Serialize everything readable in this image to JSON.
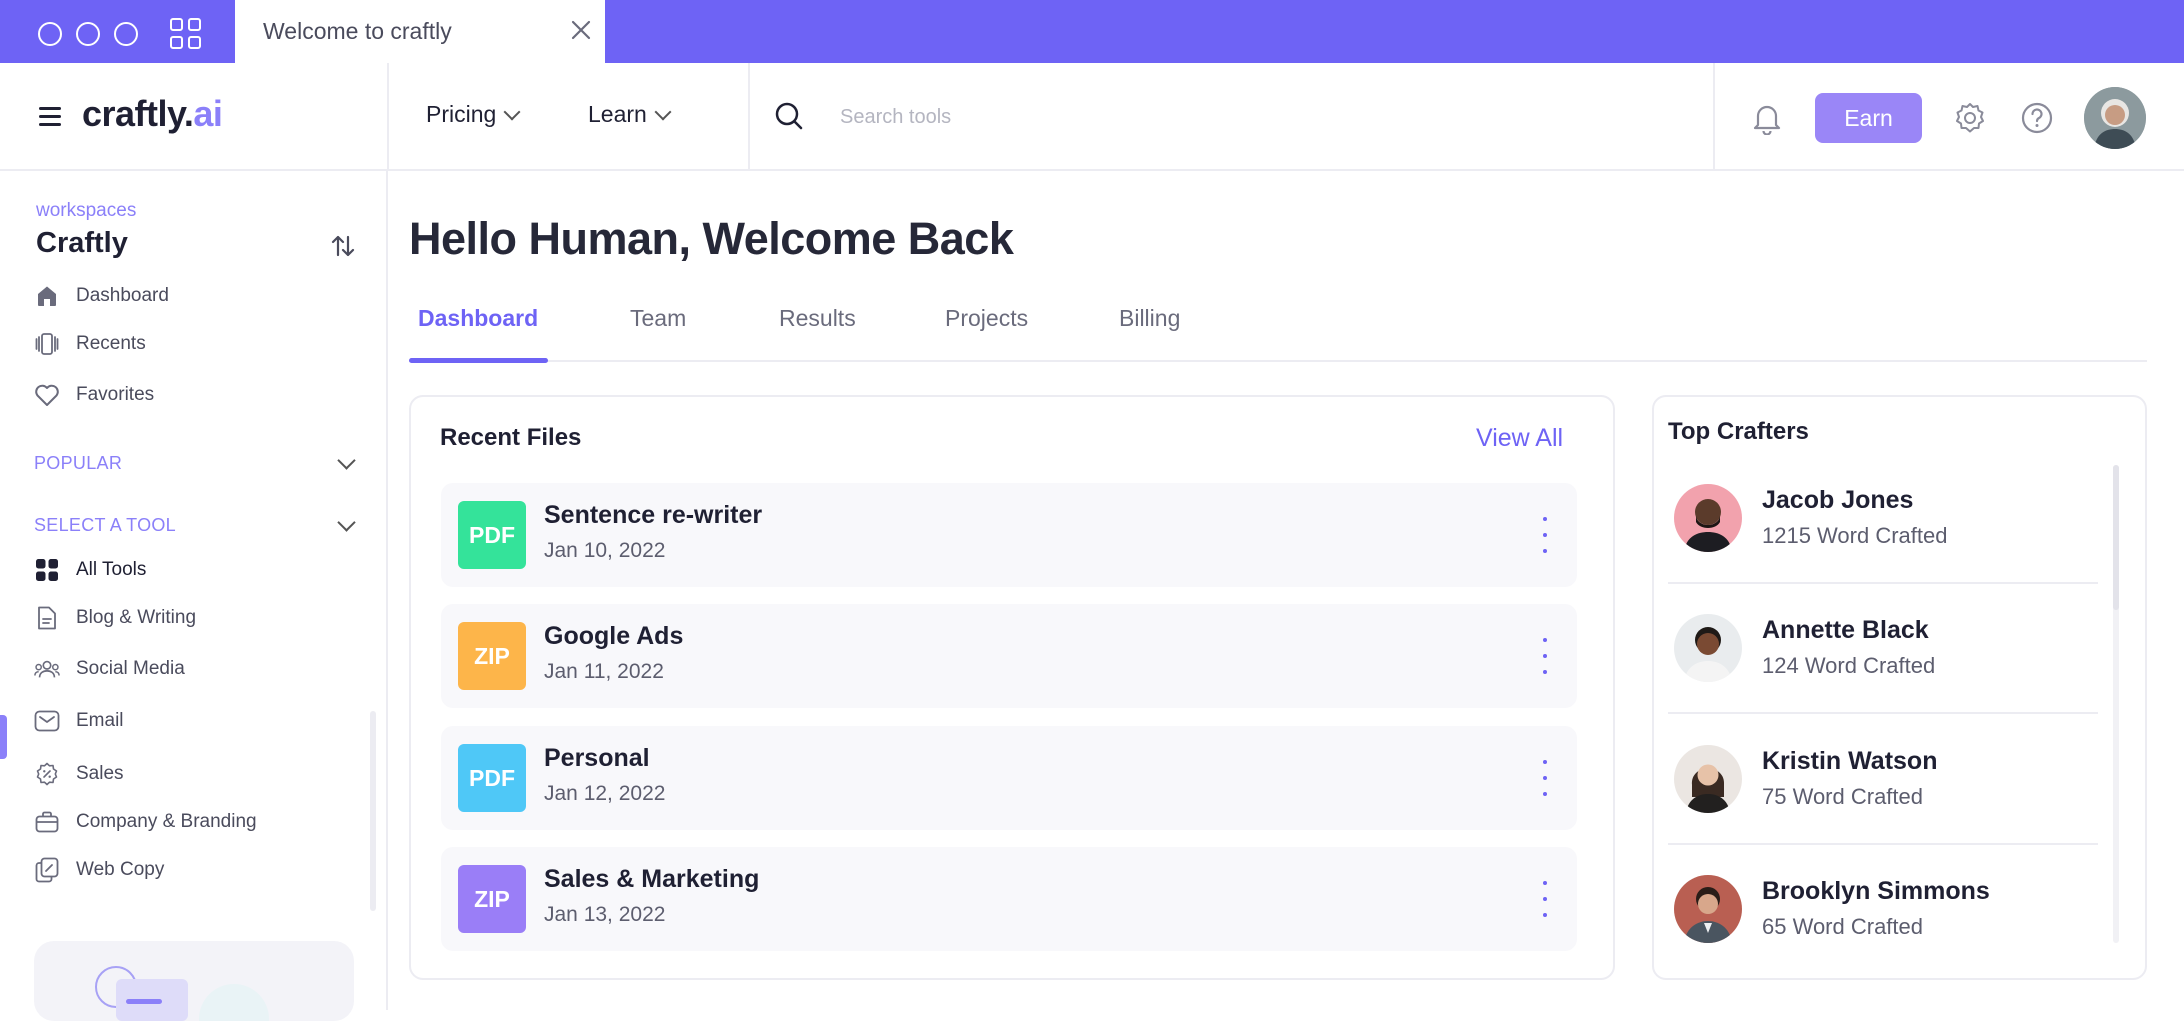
{
  "window": {
    "tab_title": "Welcome to craftly"
  },
  "header": {
    "logo_main": "craftly.",
    "logo_ai": "ai",
    "nav": [
      {
        "label": "Pricing"
      },
      {
        "label": "Learn"
      }
    ],
    "search_placeholder": "Search tools",
    "earn_label": "Earn"
  },
  "sidebar": {
    "workspace_label": "workspaces",
    "workspace_name": "Craftly",
    "items": [
      {
        "label": "Dashboard",
        "icon": "home-icon"
      },
      {
        "label": "Recents",
        "icon": "recents-icon"
      },
      {
        "label": "Favorites",
        "icon": "heart-icon"
      }
    ],
    "popular_label": "POPULAR",
    "select_tool_label": "SELECT A TOOL",
    "tools": [
      {
        "label": "All Tools",
        "icon": "grid-icon"
      },
      {
        "label": "Blog & Writing",
        "icon": "document-icon"
      },
      {
        "label": "Social Media",
        "icon": "users-icon"
      },
      {
        "label": "Email",
        "icon": "mail-icon"
      },
      {
        "label": "Sales",
        "icon": "discount-icon"
      },
      {
        "label": "Company & Branding",
        "icon": "briefcase-icon"
      },
      {
        "label": "Web Copy",
        "icon": "copy-icon"
      }
    ],
    "active_tool": "Email"
  },
  "main": {
    "greeting": "Hello Human, Welcome Back",
    "tabs": [
      {
        "label": "Dashboard"
      },
      {
        "label": "Team"
      },
      {
        "label": "Results"
      },
      {
        "label": "Projects"
      },
      {
        "label": "Billing"
      }
    ],
    "active_tab": "Dashboard",
    "recent_files": {
      "title": "Recent Files",
      "view_all": "View All",
      "files": [
        {
          "type": "PDF",
          "name": "Sentence re-writer",
          "date": "Jan 10, 2022",
          "color": "#34e39a"
        },
        {
          "type": "ZIP",
          "name": "Google Ads",
          "date": "Jan 11, 2022",
          "color": "#fdb54a"
        },
        {
          "type": "PDF",
          "name": "Personal",
          "date": "Jan 12, 2022",
          "color": "#4fc8f7"
        },
        {
          "type": "ZIP",
          "name": "Sales & Marketing",
          "date": "Jan 13, 2022",
          "color": "#9a7ef7"
        }
      ]
    },
    "top_crafters": {
      "title": "Top Crafters",
      "people": [
        {
          "name": "Jacob Jones",
          "words": "1215 Word Crafted"
        },
        {
          "name": "Annette Black",
          "words": "124 Word Crafted"
        },
        {
          "name": "Kristin Watson",
          "words": "75 Word Crafted"
        },
        {
          "name": "Brooklyn Simmons",
          "words": "65 Word Crafted"
        }
      ]
    }
  },
  "colors": {
    "brand": "#6e63f5",
    "accent_light": "#8b80f9",
    "earn_button": "#9a86f7"
  }
}
